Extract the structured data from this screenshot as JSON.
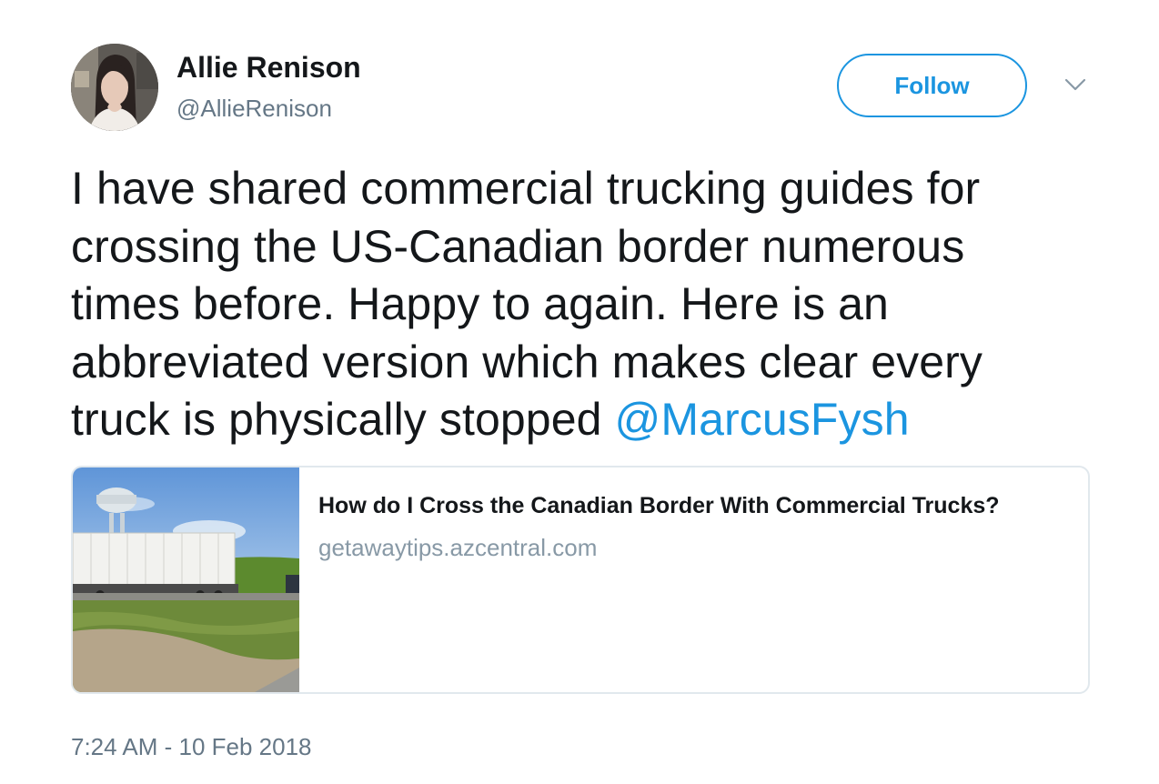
{
  "author": {
    "name": "Allie Renison",
    "handle": "@AllieRenison"
  },
  "follow_button": {
    "label": "Follow"
  },
  "tweet": {
    "text": "I have shared commercial trucking guides for\ncrossing the US-Canadian border numerous\ntimes before. Happy to again. Here is an\nabbreviated version which makes clear every\ntruck is physically stopped ",
    "mention": "@MarcusFysh",
    "timestamp": "7:24 AM - 10 Feb 2018"
  },
  "card": {
    "title": "How do I Cross the Canadian Border With Commercial Trucks?",
    "domain": "getawaytips.azcentral.com"
  },
  "colors": {
    "accent": "#1b95e0",
    "text": "#14171a",
    "secondary": "#657786",
    "border": "#e1e8ed"
  },
  "icons": {
    "caret": "chevron-down-icon"
  }
}
